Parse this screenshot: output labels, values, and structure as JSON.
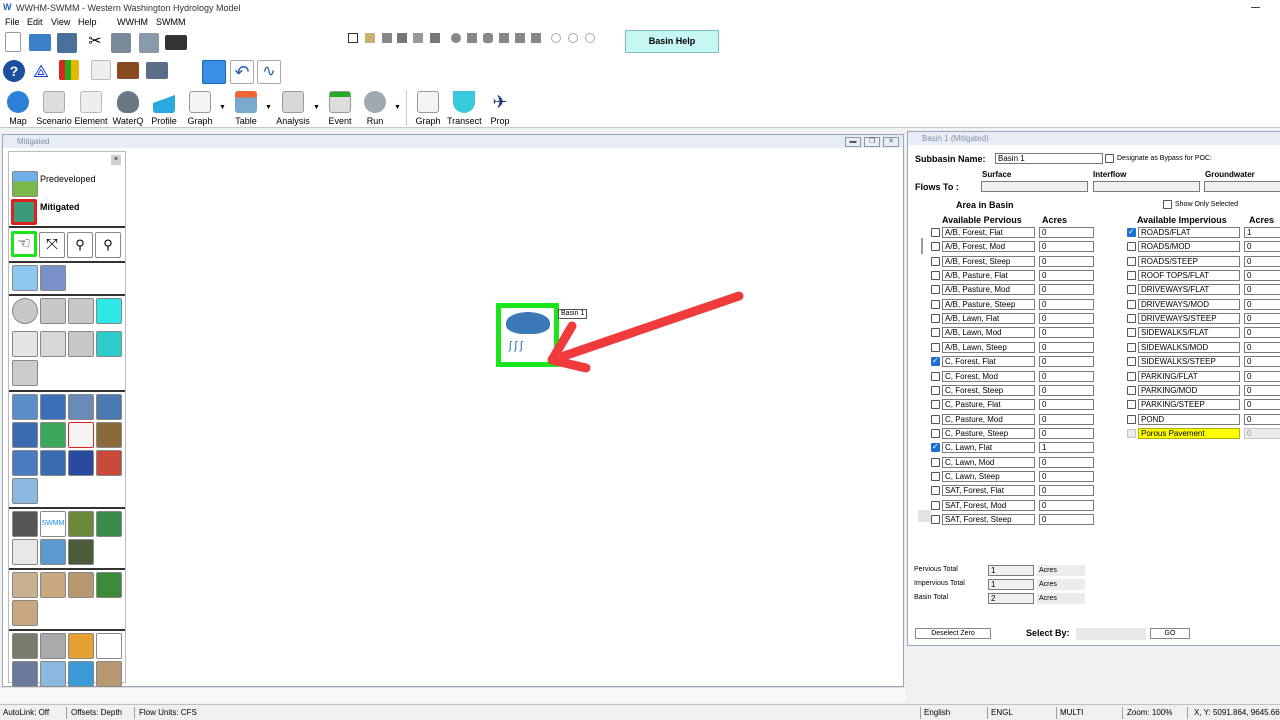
{
  "app": {
    "title": "WWHM-SWMM - Western Washington Hydrology Model"
  },
  "menu": [
    "File",
    "Edit",
    "View",
    "Help",
    "WWHM",
    "SWMM"
  ],
  "toolbar3": [
    {
      "id": "map",
      "label": "Map",
      "icon": "globe-icon"
    },
    {
      "id": "scenario",
      "label": "Scenario",
      "icon": "scenario-icon"
    },
    {
      "id": "element",
      "label": "Element",
      "icon": "element-icon"
    },
    {
      "id": "waterq",
      "label": "WaterQ",
      "icon": "water-drops-icon"
    },
    {
      "id": "profile",
      "label": "Profile",
      "icon": "profile-icon"
    },
    {
      "id": "graph",
      "label": "Graph",
      "icon": "graph-icon"
    },
    {
      "id": "table",
      "label": "Table",
      "icon": "table-icon"
    },
    {
      "id": "analysis",
      "label": "Analysis",
      "icon": "analysis-icon"
    },
    {
      "id": "event",
      "label": "Event",
      "icon": "event-icon"
    },
    {
      "id": "run",
      "label": "Run",
      "icon": "run-cloud-icon"
    },
    {
      "id": "graph2",
      "label": "Graph",
      "icon": "graph-icon"
    },
    {
      "id": "transect",
      "label": "Transect",
      "icon": "transect-icon"
    },
    {
      "id": "prop",
      "label": "Prop",
      "icon": "airplane-icon"
    }
  ],
  "basin_help": "Basin Help",
  "mitigated_window": {
    "title": "Mitigated",
    "scenarios": [
      {
        "label": "Predeveloped"
      },
      {
        "label": "Mitigated"
      }
    ],
    "canvas_element": {
      "label": "Basin 1"
    }
  },
  "basin_panel": {
    "title": "Basin 1 (Mitigated)",
    "subbasin_name_label": "Subbasin Name:",
    "subbasin_name": "Basin 1",
    "bypass_label": "Designate as Bypass for POC:",
    "flows_to_label": "Flows To :",
    "flow_headers": [
      "Surface",
      "Interflow",
      "Groundwater"
    ],
    "area_in_basin": "Area in Basin",
    "show_only_selected": "Show Only Selected",
    "pervious_header": "Available Pervious",
    "impervious_header": "Available Impervious",
    "acres_header": "Acres",
    "pervious": [
      {
        "name": "A/B, Forest, Flat",
        "checked": false,
        "acres": "0"
      },
      {
        "name": "A/B, Forest, Mod",
        "checked": false,
        "acres": "0"
      },
      {
        "name": "A/B, Forest, Steep",
        "checked": false,
        "acres": "0"
      },
      {
        "name": "A/B, Pasture, Flat",
        "checked": false,
        "acres": "0"
      },
      {
        "name": "A/B, Pasture, Mod",
        "checked": false,
        "acres": "0"
      },
      {
        "name": "A/B, Pasture, Steep",
        "checked": false,
        "acres": "0"
      },
      {
        "name": "A/B, Lawn, Flat",
        "checked": false,
        "acres": "0"
      },
      {
        "name": "A/B, Lawn, Mod",
        "checked": false,
        "acres": "0"
      },
      {
        "name": "A/B, Lawn, Steep",
        "checked": false,
        "acres": "0"
      },
      {
        "name": "C, Forest, Flat",
        "checked": true,
        "acres": "0"
      },
      {
        "name": "C, Forest, Mod",
        "checked": false,
        "acres": "0"
      },
      {
        "name": "C, Forest, Steep",
        "checked": false,
        "acres": "0"
      },
      {
        "name": "C, Pasture, Flat",
        "checked": false,
        "acres": "0"
      },
      {
        "name": "C, Pasture, Mod",
        "checked": false,
        "acres": "0"
      },
      {
        "name": "C, Pasture, Steep",
        "checked": false,
        "acres": "0"
      },
      {
        "name": "C, Lawn, Flat",
        "checked": true,
        "acres": "1"
      },
      {
        "name": "C, Lawn, Mod",
        "checked": false,
        "acres": "0"
      },
      {
        "name": "C, Lawn, Steep",
        "checked": false,
        "acres": "0"
      },
      {
        "name": "SAT, Forest, Flat",
        "checked": false,
        "acres": "0"
      },
      {
        "name": "SAT, Forest, Mod",
        "checked": false,
        "acres": "0"
      },
      {
        "name": "SAT, Forest, Steep",
        "checked": false,
        "acres": "0"
      }
    ],
    "impervious": [
      {
        "name": "ROADS/FLAT",
        "checked": true,
        "acres": "1"
      },
      {
        "name": "ROADS/MOD",
        "checked": false,
        "acres": "0"
      },
      {
        "name": "ROADS/STEEP",
        "checked": false,
        "acres": "0"
      },
      {
        "name": "ROOF TOPS/FLAT",
        "checked": false,
        "acres": "0"
      },
      {
        "name": "DRIVEWAYS/FLAT",
        "checked": false,
        "acres": "0"
      },
      {
        "name": "DRIVEWAYS/MOD",
        "checked": false,
        "acres": "0"
      },
      {
        "name": "DRIVEWAYS/STEEP",
        "checked": false,
        "acres": "0"
      },
      {
        "name": "SIDEWALKS/FLAT",
        "checked": false,
        "acres": "0"
      },
      {
        "name": "SIDEWALKS/MOD",
        "checked": false,
        "acres": "0"
      },
      {
        "name": "SIDEWALKS/STEEP",
        "checked": false,
        "acres": "0"
      },
      {
        "name": "PARKING/FLAT",
        "checked": false,
        "acres": "0"
      },
      {
        "name": "PARKING/MOD",
        "checked": false,
        "acres": "0"
      },
      {
        "name": "PARKING/STEEP",
        "checked": false,
        "acres": "0"
      },
      {
        "name": "POND",
        "checked": false,
        "acres": "0"
      },
      {
        "name": "Porous Pavement",
        "checked": false,
        "acres": "0",
        "highlight": "#ffff00",
        "disabled": true
      }
    ],
    "totals": [
      {
        "label": "Pervious Total",
        "value": "1",
        "unit": "Acres"
      },
      {
        "label": "Impervious Total",
        "value": "1",
        "unit": "Acres"
      },
      {
        "label": "Basin Total",
        "value": "2",
        "unit": "Acres"
      }
    ],
    "deselect_zero": "Deselect Zero",
    "select_by_label": "Select By:",
    "go_label": "GO"
  },
  "status": {
    "autolink": "AutoLink: Off",
    "offsets": "Offsets: Depth",
    "flow_units": "Flow Units: CFS",
    "language": "English",
    "units": "ENGL",
    "mode": "MULTI",
    "zoom": "Zoom: 100%",
    "coords": "X, Y: 5091.864,  9645.66"
  },
  "colors": {
    "accent_green": "#19e619",
    "arrow_red": "#ef3b3b",
    "basin_help_bg": "#c6f6f4",
    "highlight_yellow": "#ffff00"
  }
}
